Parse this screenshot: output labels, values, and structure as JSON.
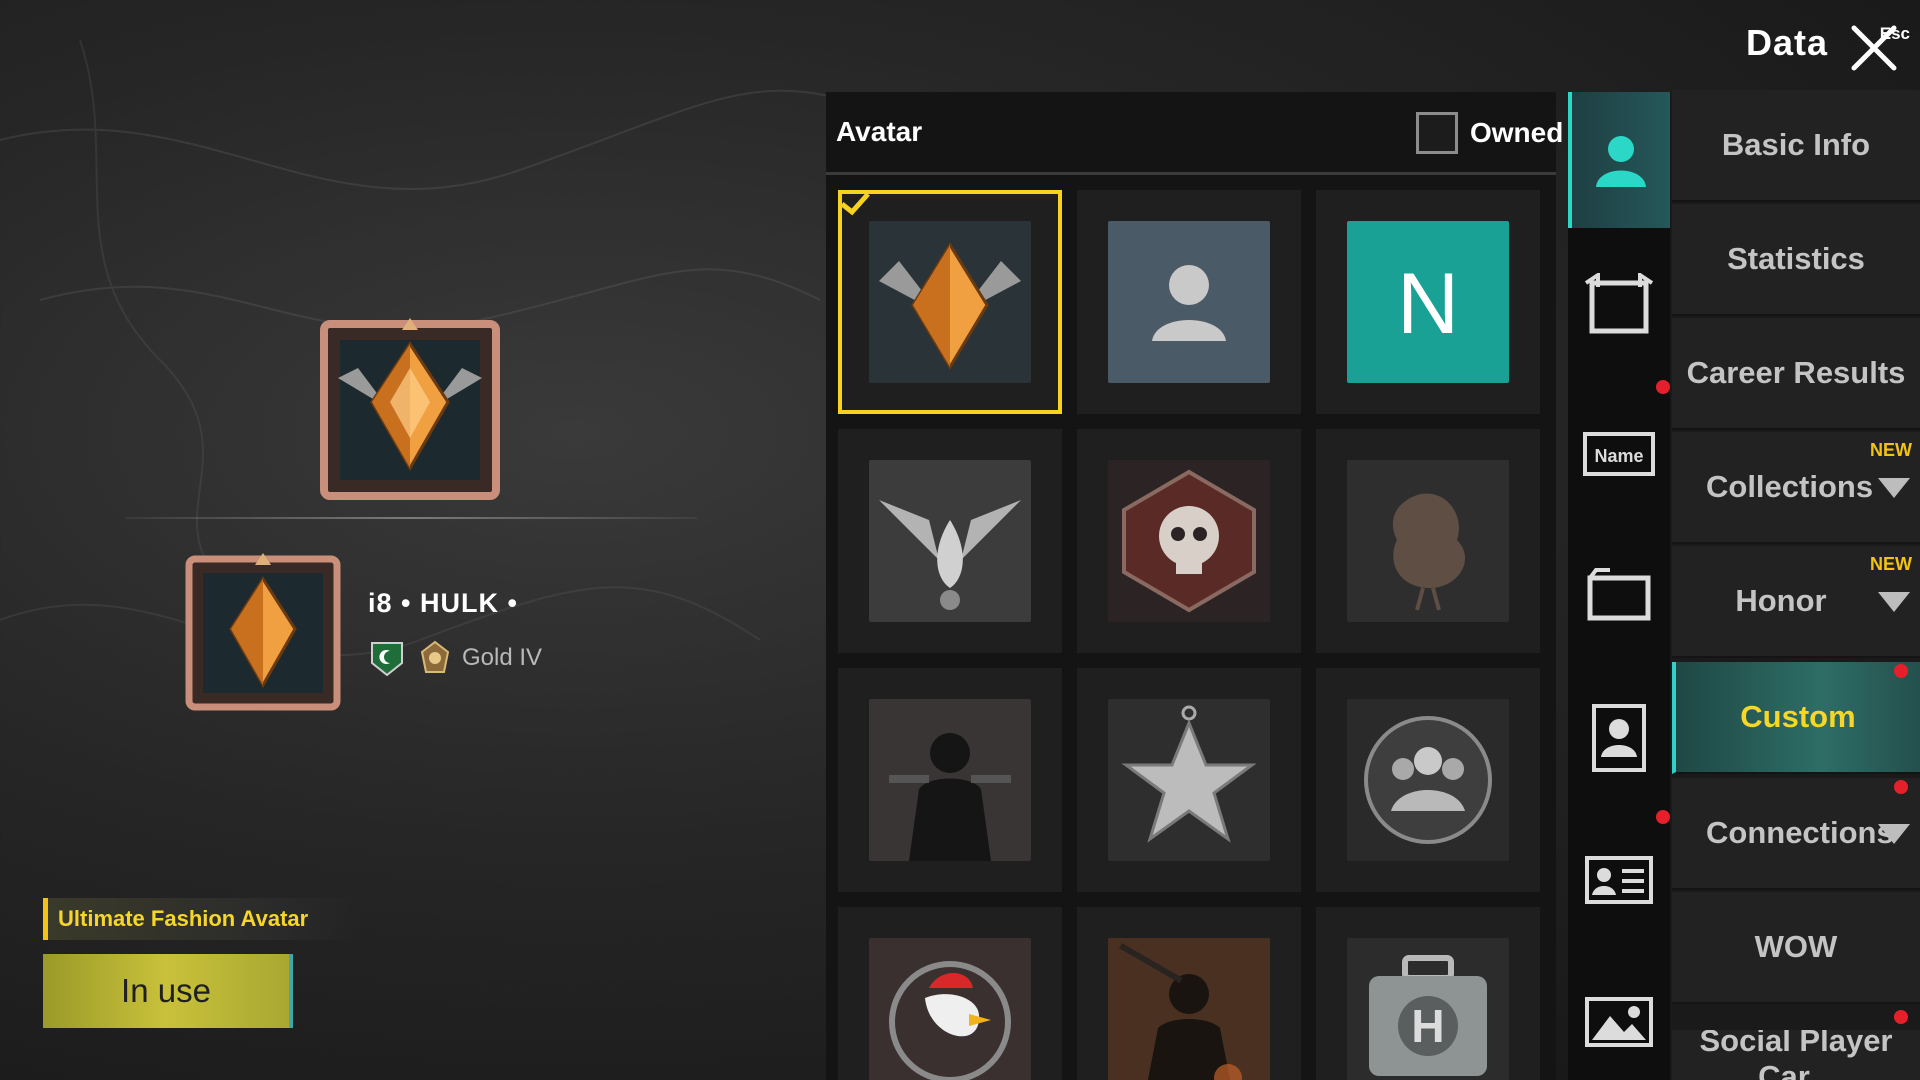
{
  "header": {
    "title": "Data",
    "close_hint": "Esc"
  },
  "profile": {
    "player_name": "i8 • HULK •",
    "rank": "Gold IV",
    "avatar_name": "Ultimate Fashion Avatar",
    "use_button": "In use"
  },
  "panel": {
    "title": "Avatar",
    "owned_label": "Owned",
    "owned_checked": false,
    "avatars": [
      {
        "name": "gold-crest-avatar",
        "selected": true
      },
      {
        "name": "default-silhouette-avatar",
        "selected": false
      },
      {
        "name": "letter-avatar",
        "letter": "N",
        "color": "#19a196",
        "selected": false
      },
      {
        "name": "winged-flame-avatar",
        "selected": false
      },
      {
        "name": "skull-emblem-avatar",
        "selected": false
      },
      {
        "name": "chicken-emblem-avatar",
        "selected": false
      },
      {
        "name": "gunman-avatar",
        "selected": false
      },
      {
        "name": "star-medal-avatar",
        "selected": false
      },
      {
        "name": "squad-emblem-avatar",
        "selected": false
      },
      {
        "name": "rooster-avatar",
        "selected": false
      },
      {
        "name": "soldier-avatar",
        "selected": false
      },
      {
        "name": "medkit-avatar",
        "selected": false
      }
    ]
  },
  "icon_tabs": [
    "avatar-tab",
    "frame-tab",
    "nameplate-tab",
    "banner-tab",
    "portrait-tab",
    "id-card-tab",
    "background-tab"
  ],
  "nameplate_icon_text": "Name",
  "nav": {
    "items": [
      {
        "label": "Basic Info"
      },
      {
        "label": "Statistics"
      },
      {
        "label": "Career Results"
      },
      {
        "label": "Collections",
        "badge": "NEW",
        "expandable": true
      },
      {
        "label": "Honor",
        "badge": "NEW",
        "expandable": true
      },
      {
        "label": "Custom",
        "active": true
      },
      {
        "label": "Connections",
        "expandable": true
      },
      {
        "label": "WOW"
      },
      {
        "label": "Social Player Car..."
      }
    ]
  },
  "colors": {
    "accent": "#f6d629",
    "teal": "#2bd7c7",
    "notify": "#e5202a"
  }
}
